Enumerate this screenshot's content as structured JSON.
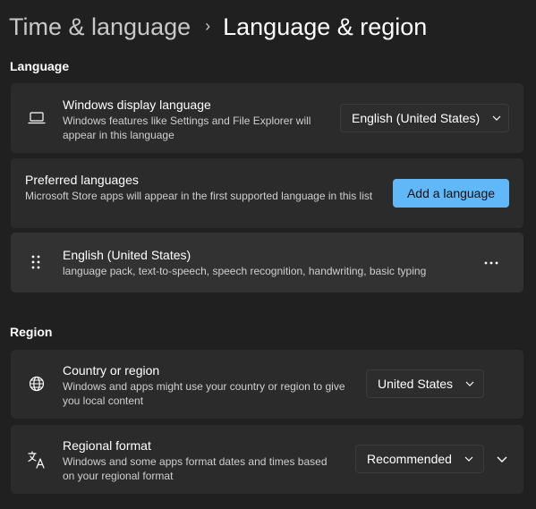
{
  "breadcrumb": {
    "parent": "Time & language",
    "separator": "›",
    "current": "Language & region"
  },
  "language_section": {
    "title": "Language",
    "display_language": {
      "icon": "laptop-icon",
      "title": "Windows display language",
      "description": "Windows features like Settings and File Explorer will appear in this language",
      "selected": "English (United States)"
    },
    "preferred_languages": {
      "title": "Preferred languages",
      "description": "Microsoft Store apps will appear in the first supported language in this list",
      "add_button": "Add a language"
    },
    "languages": [
      {
        "name": "English (United States)",
        "features": "language pack, text-to-speech, speech recognition, handwriting, basic typing"
      }
    ]
  },
  "region_section": {
    "title": "Region",
    "country": {
      "icon": "globe-icon",
      "title": "Country or region",
      "description": "Windows and apps might use your country or region to give you local content",
      "selected": "United States"
    },
    "regional_format": {
      "icon": "language-format-icon",
      "title": "Regional format",
      "description": "Windows and some apps format dates and times based on your regional format",
      "selected": "Recommended"
    }
  },
  "colors": {
    "background": "#202020",
    "card": "#2b2b2b",
    "accent": "#60b8f8"
  }
}
